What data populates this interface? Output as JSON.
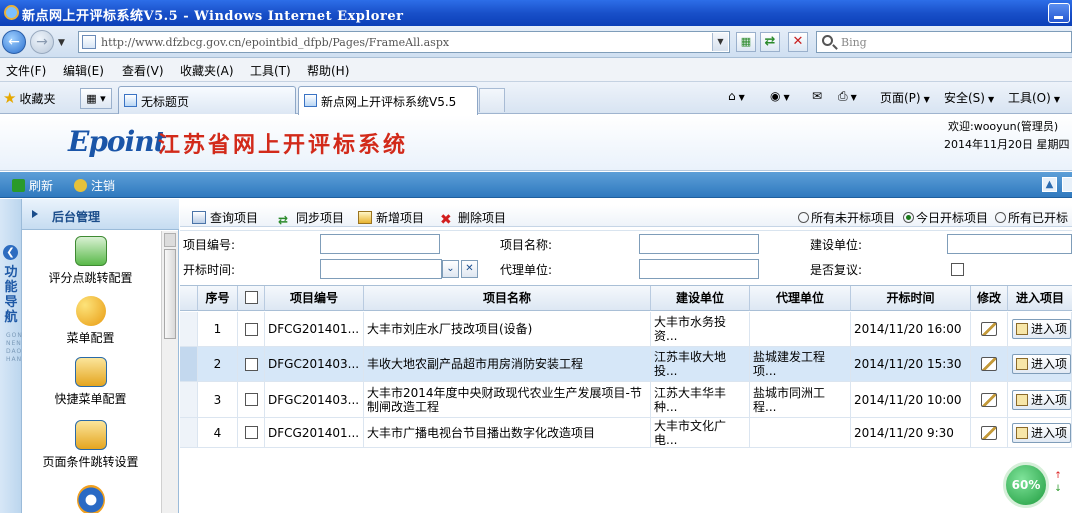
{
  "browser": {
    "window_title": "新点网上开评标系统V5.5 - Windows Internet Explorer",
    "url": "http://www.dfzbcg.gov.cn/epointbid_dfpb/Pages/FrameAll.aspx",
    "search_placeholder": "Bing",
    "menu": [
      "文件(F)",
      "编辑(E)",
      "查看(V)",
      "收藏夹(A)",
      "工具(T)",
      "帮助(H)"
    ],
    "favorites_label": "收藏夹",
    "tabs": [
      "无标题页",
      "新点网上开评标系统V5.5"
    ],
    "commands": {
      "page": "页面(P)",
      "safety": "安全(S)",
      "tools": "工具(O)"
    }
  },
  "app": {
    "logo": "Epoint",
    "system_title": "江苏省网上开评标系统",
    "welcome": "欢迎:wooyun(管理员)",
    "date": "2014年11月20日 星期四",
    "toolbar": {
      "refresh": "刷新",
      "logout": "注销"
    }
  },
  "sidebar": {
    "strip_label": "功能导航",
    "strip_pinyin": "GONG NENG DAO HANG",
    "header": "后台管理",
    "items": [
      "评分点跳转配置",
      "菜单配置",
      "快捷菜单配置",
      "页面条件跳转设置"
    ]
  },
  "main_toolbar": {
    "query": "查询项目",
    "sync": "同步项目",
    "add": "新增项目",
    "delete": "删除项目",
    "radios": [
      "所有未开标项目",
      "今日开标项目",
      "所有已开标"
    ],
    "selected_radio": "今日开标项目"
  },
  "search_form": {
    "project_no": "项目编号:",
    "project_name": "项目名称:",
    "build_unit": "建设单位:",
    "open_time": "开标时间:",
    "agent_unit": "代理单位:",
    "recheck": "是否复议:"
  },
  "grid": {
    "columns": [
      "序号",
      "",
      "项目编号",
      "项目名称",
      "建设单位",
      "代理单位",
      "开标时间",
      "修改",
      "进入项目"
    ],
    "rows": [
      {
        "no": "1",
        "code": "DFCG201401...",
        "name": "大丰市刘庄水厂技改项目(设备)",
        "build": "大丰市水务投资...",
        "agent": "",
        "time": "2014/11/20 16:00",
        "enter": "进入项"
      },
      {
        "no": "2",
        "code": "DFGC201403...",
        "name": "丰收大地农副产品超市用房消防安装工程",
        "build": "江苏丰收大地投...",
        "agent": "盐城建发工程项...",
        "time": "2014/11/20 15:30",
        "enter": "进入项"
      },
      {
        "no": "3",
        "code": "DFGC201403...",
        "name": "大丰市2014年度中央财政现代农业生产发展项目-节制闸改造工程",
        "build": "江苏大丰华丰种...",
        "agent": "盐城市同洲工程...",
        "time": "2014/11/20 10:00",
        "enter": "进入项"
      },
      {
        "no": "4",
        "code": "DFCG201401...",
        "name": "大丰市广播电视台节目播出数字化改造项目",
        "build": "大丰市文化广电...",
        "agent": "",
        "time": "2014/11/20 9:30",
        "enter": "进入项"
      }
    ]
  },
  "progress": {
    "percent": "60%",
    "value": 60
  },
  "colors": {
    "titlebar": "#1950c9",
    "app_toolbar": "#2f79bf",
    "system_title": "#d22a1a",
    "logo": "#1a55a8",
    "selected_row": "#d6e7f8"
  }
}
